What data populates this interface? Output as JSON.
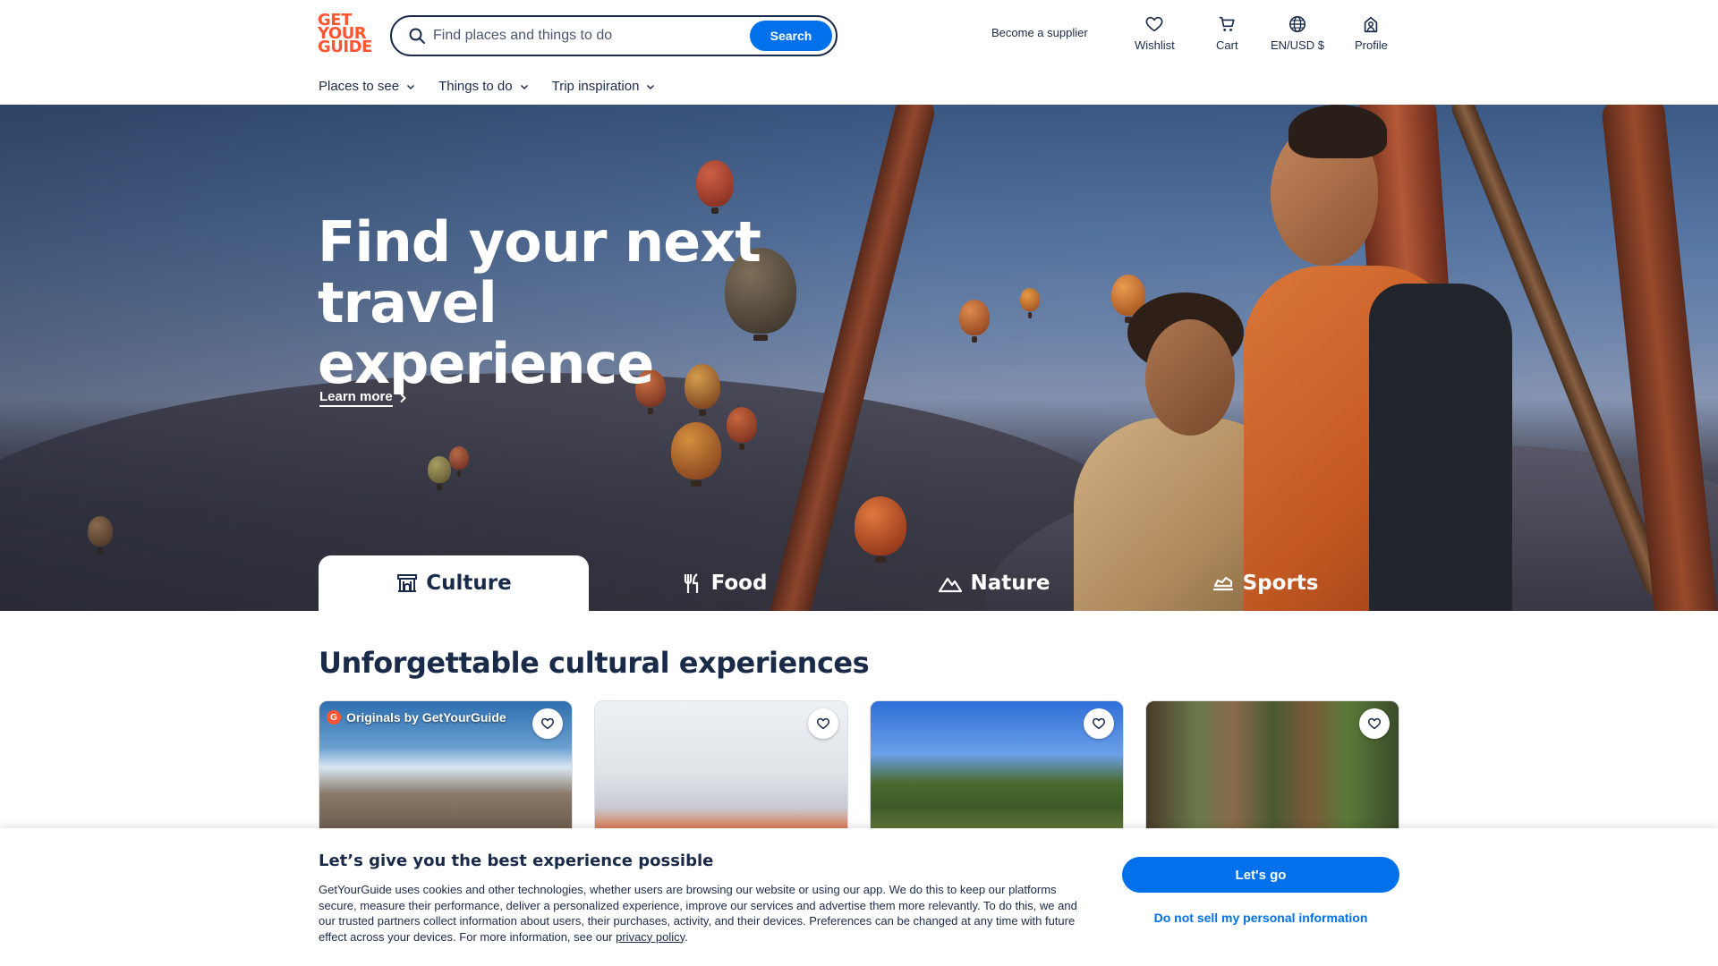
{
  "header": {
    "logo_lines": [
      "GET",
      "YOUR",
      "GUIDE"
    ],
    "search_placeholder": "Find places and things to do",
    "search_button": "Search",
    "become_supplier": "Become a supplier",
    "wishlist": "Wishlist",
    "cart": "Cart",
    "locale": "EN/USD $",
    "profile": "Profile"
  },
  "subnav": [
    "Places to see",
    "Things to do",
    "Trip inspiration"
  ],
  "hero": {
    "title_line1": "Find your next travel",
    "title_line2": "experience",
    "learn_more": "Learn more",
    "tabs": [
      "Culture",
      "Food",
      "Nature",
      "Sports"
    ],
    "active_tab": "Culture"
  },
  "section": {
    "title": "Unforgettable cultural experiences",
    "cards": [
      {
        "badge": "Originals by GetYourGuide",
        "badge_icon_letter": "G"
      },
      {
        "badge": ""
      },
      {
        "badge": ""
      },
      {
        "badge": ""
      }
    ]
  },
  "cookie": {
    "title": "Let’s give you the best experience possible",
    "text": "GetYourGuide uses cookies and other technologies, whether users are browsing our website or using our app. We do this to keep our platforms secure, measure their performance, deliver a personalized experience, improve our services and advertise them more relevantly. To do this, we and our trusted partners collect information about users, their purchases, activity, and their devices. Preferences can be changed at any time with future effect across your devices. For more information, see our ",
    "privacy_link": "privacy policy",
    "text_end": ".",
    "accept": "Let's go",
    "do_not_sell": "Do not sell my personal information"
  },
  "colors": {
    "brand_orange": "#ff5533",
    "primary_blue": "#0071eb",
    "navy": "#1a2b49"
  },
  "icons": [
    "search-icon",
    "heart-icon",
    "cart-icon",
    "globe-icon",
    "profile-icon",
    "chevron-down-icon",
    "chevron-right-icon",
    "museum-icon",
    "utensils-icon",
    "mountain-icon",
    "sports-icon"
  ]
}
